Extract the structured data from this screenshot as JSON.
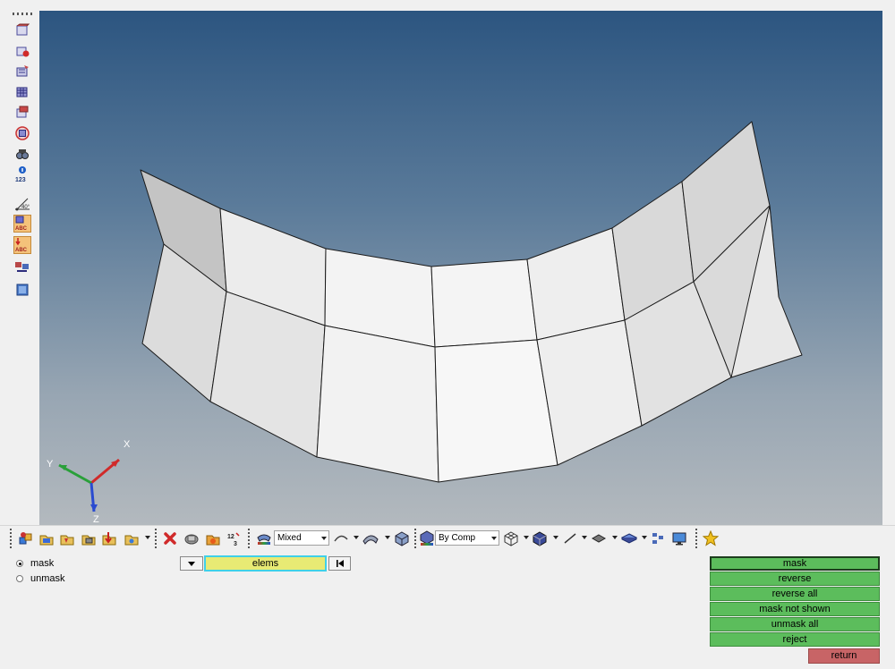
{
  "colors": {
    "viewport_top": "#2c5580",
    "viewport_bottom": "#b3b9be",
    "panel_button_green": "#5cbd5c",
    "return_button_red": "#c86466",
    "selector_field_yellow": "#e8ea74",
    "selector_field_border": "#3fd0e8",
    "axis_x": "#d02a2a",
    "axis_y": "#2aa03a",
    "axis_z": "#2a4bd0"
  },
  "left_toolbar": {
    "icons": [
      "display-icon",
      "mask-icon",
      "find-icon",
      "show-all-icon",
      "reverse-display-icon",
      "isolate-icon",
      "find-attached-icon",
      "info-icon",
      "measure-icon",
      "hide-element-labels-icon",
      "show-element-labels-icon",
      "numbering-icon",
      "fit-view-icon"
    ]
  },
  "viewport": {
    "axes": {
      "x_label": "X",
      "y_label": "Y",
      "z_label": "Z"
    }
  },
  "bottom_toolbar": {
    "display_mode": "Mixed",
    "color_mode": "By Comp"
  },
  "panel": {
    "radio_options": [
      {
        "label": "mask",
        "selected": true
      },
      {
        "label": "unmask",
        "selected": false
      }
    ],
    "selector_value": "elems",
    "buttons": [
      "mask",
      "reverse",
      "reverse all",
      "mask not shown",
      "unmask all",
      "reject"
    ],
    "return_label": "return"
  }
}
